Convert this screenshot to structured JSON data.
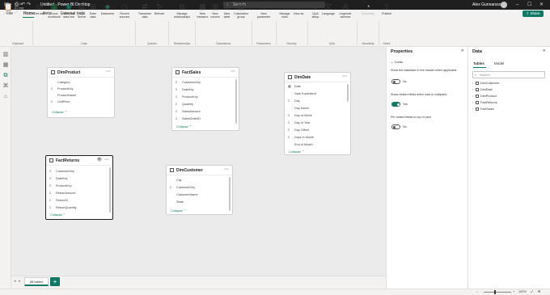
{
  "window": {
    "title": "Untitled - Power BI Desktop",
    "search_placeholder": "Search",
    "user_name": "Alex Gunnarsson"
  },
  "menu": {
    "items": [
      "File",
      "Home",
      "Help",
      "External tools"
    ],
    "active": "Home",
    "share_label": "Share"
  },
  "ribbon": {
    "buttons": [
      {
        "label": "Paste",
        "icon": "paste-icon",
        "disabled": true
      },
      {
        "label": "Get data",
        "icon": "get-data-icon"
      },
      {
        "label": "Excel workbook",
        "icon": "excel-icon"
      },
      {
        "label": "OneLake data hub",
        "icon": "onelake-icon"
      },
      {
        "label": "SQL Server",
        "icon": "sql-server-icon"
      },
      {
        "label": "Enter data",
        "icon": "table-grid-icon"
      },
      {
        "label": "Dataverse",
        "icon": "dataverse-icon"
      },
      {
        "label": "Recent sources",
        "icon": "recent-sources-icon"
      },
      {
        "label": "Transform data",
        "icon": "transform-data-icon"
      },
      {
        "label": "Refresh",
        "icon": "refresh-icon"
      },
      {
        "label": "Manage relationships",
        "icon": "manage-relationships-icon"
      },
      {
        "label": "New measure",
        "icon": "new-measure-icon"
      },
      {
        "label": "New column",
        "icon": "new-column-icon"
      },
      {
        "label": "New table",
        "icon": "new-table-icon"
      },
      {
        "label": "Calculation group",
        "icon": "calculation-group-icon"
      },
      {
        "label": "New parameter",
        "icon": "new-parameter-icon"
      },
      {
        "label": "Manage roles",
        "icon": "manage-roles-icon"
      },
      {
        "label": "View as",
        "icon": "view-as-icon"
      },
      {
        "label": "Q&A setup",
        "icon": "qa-setup-icon"
      },
      {
        "label": "Language",
        "icon": "language-icon"
      },
      {
        "label": "Linguistic schema",
        "icon": "linguistic-schema-icon"
      },
      {
        "label": "Sensitivity",
        "icon": "sensitivity-icon",
        "disabled": true
      },
      {
        "label": "Publish",
        "icon": "publish-icon"
      }
    ],
    "small_buttons": [
      "Cut",
      "Copy",
      "Format painter"
    ],
    "groups": [
      "Clipboard",
      "Data",
      "Queries",
      "Relationships",
      "Calculations",
      "Parameters",
      "Security",
      "Q&A",
      "Sensitivity",
      "Share"
    ]
  },
  "left_rail": [
    "report-view-icon",
    "table-view-icon",
    "model-view-icon",
    "dax-query-view-icon",
    "tmdl-view-icon"
  ],
  "tables": [
    {
      "id": "DimProduct",
      "name": "DimProduct",
      "fields": [
        {
          "name": "Category",
          "icon": ""
        },
        {
          "name": "ProductKey",
          "icon": "Σ"
        },
        {
          "name": "ProductName",
          "icon": ""
        },
        {
          "name": "UnitPrice",
          "icon": "Σ"
        }
      ],
      "collapse": "Collapse"
    },
    {
      "id": "FactSales",
      "name": "FactSales",
      "fields": [
        {
          "name": "CustomerKey",
          "icon": "Σ"
        },
        {
          "name": "DateKey",
          "icon": "Σ"
        },
        {
          "name": "ProductKey",
          "icon": "Σ"
        },
        {
          "name": "Quantity",
          "icon": "Σ"
        },
        {
          "name": "SalesAmount",
          "icon": "Σ"
        },
        {
          "name": "SalesOrderID",
          "icon": "Σ"
        }
      ],
      "collapse": "Collapse"
    },
    {
      "id": "DimDate",
      "name": "DimDate",
      "fields": [
        {
          "name": "Date",
          "icon": "▦"
        },
        {
          "name": "Date Equivalent",
          "icon": ""
        },
        {
          "name": "Day",
          "icon": "Σ"
        },
        {
          "name": "Day Name",
          "icon": ""
        },
        {
          "name": "Day of Week",
          "icon": "Σ"
        },
        {
          "name": "Day of Year",
          "icon": "Σ"
        },
        {
          "name": "Day Offset",
          "icon": "Σ"
        },
        {
          "name": "Days in Month",
          "icon": "Σ"
        },
        {
          "name": "End of Month",
          "icon": ""
        }
      ],
      "collapse": "Collapse"
    },
    {
      "id": "FactReturns",
      "name": "FactReturns",
      "fields": [
        {
          "name": "CustomerKey",
          "icon": "Σ"
        },
        {
          "name": "DateKey",
          "icon": "Σ"
        },
        {
          "name": "ProductKey",
          "icon": "Σ"
        },
        {
          "name": "ReturnAmount",
          "icon": "Σ"
        },
        {
          "name": "ReturnID",
          "icon": "Σ"
        },
        {
          "name": "ReturnQuantity",
          "icon": "Σ"
        }
      ],
      "collapse": "Collapse"
    },
    {
      "id": "DimCustomer",
      "name": "DimCustomer",
      "fields": [
        {
          "name": "City",
          "icon": ""
        },
        {
          "name": "CustomerKey",
          "icon": "Σ"
        },
        {
          "name": "CustomerName",
          "icon": ""
        },
        {
          "name": "State",
          "icon": ""
        }
      ],
      "collapse": "Collapse"
    }
  ],
  "tabs": {
    "items": [
      "All tables"
    ],
    "add_label": "+"
  },
  "properties": {
    "title": "Properties",
    "section": "Cards",
    "settings": [
      {
        "text": "Show the database in the header when applicable",
        "state": "No",
        "on": false
      },
      {
        "text": "Show related fields when card is collapsed",
        "state": "Yes",
        "on": true
      },
      {
        "text": "Pin related fields to top of card",
        "state": "No",
        "on": false
      }
    ]
  },
  "data_pane": {
    "title": "Data",
    "tabs": [
      "Tables",
      "Model"
    ],
    "active_tab": "Tables",
    "search_placeholder": "Search",
    "tables": [
      "DimCustomer",
      "DimDate",
      "DimProduct",
      "FactReturns",
      "FactSales"
    ]
  },
  "status": {
    "zoom": "100%",
    "zoom_fraction": 0.4
  }
}
